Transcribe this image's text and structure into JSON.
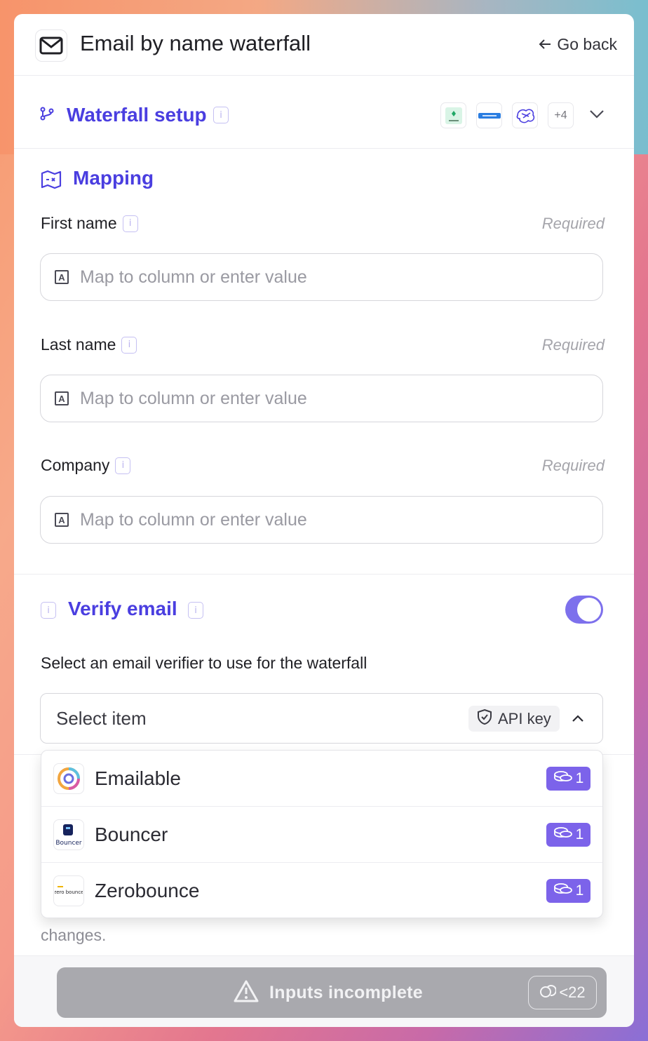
{
  "header": {
    "title": "Email by name waterfall",
    "go_back": "Go back"
  },
  "waterfall": {
    "title": "Waterfall setup",
    "more_count": "+4"
  },
  "mapping": {
    "title": "Mapping",
    "fields": [
      {
        "label": "First name",
        "required": "Required",
        "placeholder": "Map to column or enter value"
      },
      {
        "label": "Last name",
        "required": "Required",
        "placeholder": "Map to column or enter value"
      },
      {
        "label": "Company",
        "required": "Required",
        "placeholder": "Map to column or enter value"
      }
    ]
  },
  "verify": {
    "title": "Verify email",
    "enabled": true,
    "description": "Select an email verifier to use for the waterfall",
    "select_placeholder": "Select item",
    "api_chip": "API key",
    "options": [
      {
        "name": "Emailable",
        "cost": "1"
      },
      {
        "name": "Bouncer",
        "cost": "1"
      },
      {
        "name": "Zerobounce",
        "cost": "1"
      }
    ]
  },
  "under_text": "changes.",
  "cta": {
    "label": "Inputs incomplete",
    "credits": "<22"
  },
  "colors": {
    "accent": "#4a3ee0",
    "toggle": "#7d70ec",
    "cost_badge": "#7c63ea",
    "cta_disabled": "#a9a9ae"
  }
}
